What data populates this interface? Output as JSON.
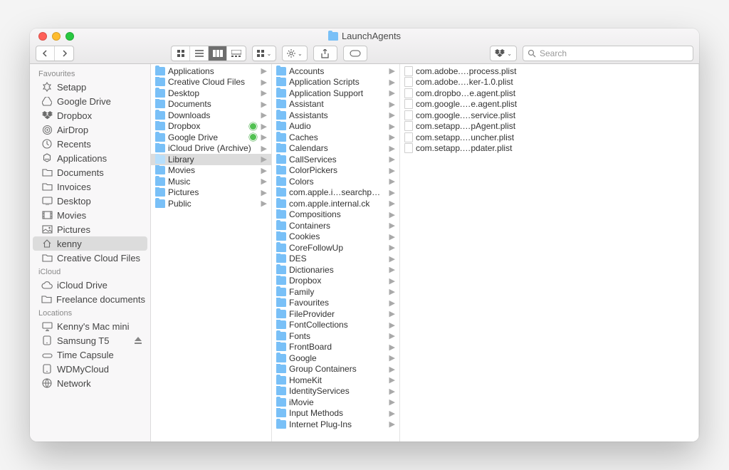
{
  "window": {
    "title": "LaunchAgents"
  },
  "search": {
    "placeholder": "Search"
  },
  "sidebar": {
    "sections": [
      {
        "title": "Favourites",
        "items": [
          {
            "icon": "setapp",
            "label": "Setapp"
          },
          {
            "icon": "gdrive",
            "label": "Google Drive"
          },
          {
            "icon": "dropbox",
            "label": "Dropbox"
          },
          {
            "icon": "airdrop",
            "label": "AirDrop"
          },
          {
            "icon": "recents",
            "label": "Recents"
          },
          {
            "icon": "apps",
            "label": "Applications"
          },
          {
            "icon": "folder",
            "label": "Documents"
          },
          {
            "icon": "folder",
            "label": "Invoices"
          },
          {
            "icon": "desktop",
            "label": "Desktop"
          },
          {
            "icon": "movies",
            "label": "Movies"
          },
          {
            "icon": "pictures",
            "label": "Pictures"
          },
          {
            "icon": "home",
            "label": "kenny",
            "selected": true
          },
          {
            "icon": "folder",
            "label": "Creative Cloud Files"
          }
        ]
      },
      {
        "title": "iCloud",
        "items": [
          {
            "icon": "cloud",
            "label": "iCloud Drive"
          },
          {
            "icon": "folder",
            "label": "Freelance documents"
          }
        ]
      },
      {
        "title": "Locations",
        "items": [
          {
            "icon": "imac",
            "label": "Kenny's Mac mini"
          },
          {
            "icon": "disk",
            "label": "Samsung T5",
            "eject": true
          },
          {
            "icon": "timecap",
            "label": "Time Capsule"
          },
          {
            "icon": "disk",
            "label": "WDMyCloud"
          },
          {
            "icon": "globe",
            "label": "Network"
          }
        ]
      }
    ]
  },
  "columns": [
    {
      "items": [
        {
          "t": "folder",
          "label": "Applications",
          "chev": true
        },
        {
          "t": "folder",
          "label": "Creative Cloud Files",
          "chev": true
        },
        {
          "t": "folder",
          "label": "Desktop",
          "chev": true
        },
        {
          "t": "folder",
          "label": "Documents",
          "chev": true
        },
        {
          "t": "folder",
          "label": "Downloads",
          "chev": true
        },
        {
          "t": "folder",
          "label": "Dropbox",
          "chev": true,
          "sync": true
        },
        {
          "t": "folder",
          "label": "Google Drive",
          "chev": true,
          "sync": true
        },
        {
          "t": "folder",
          "label": "iCloud Drive (Archive)",
          "chev": true
        },
        {
          "t": "folder-lite",
          "label": "Library",
          "chev": true,
          "selected": true
        },
        {
          "t": "folder",
          "label": "Movies",
          "chev": true
        },
        {
          "t": "folder",
          "label": "Music",
          "chev": true
        },
        {
          "t": "folder",
          "label": "Pictures",
          "chev": true
        },
        {
          "t": "folder",
          "label": "Public",
          "chev": true
        }
      ]
    },
    {
      "items": [
        {
          "t": "folder",
          "label": "Accounts",
          "chev": true
        },
        {
          "t": "folder",
          "label": "Application Scripts",
          "chev": true
        },
        {
          "t": "folder",
          "label": "Application Support",
          "chev": true
        },
        {
          "t": "folder",
          "label": "Assistant",
          "chev": true
        },
        {
          "t": "folder",
          "label": "Assistants",
          "chev": true
        },
        {
          "t": "folder",
          "label": "Audio",
          "chev": true
        },
        {
          "t": "folder",
          "label": "Caches",
          "chev": true
        },
        {
          "t": "folder",
          "label": "Calendars",
          "chev": true
        },
        {
          "t": "folder",
          "label": "CallServices",
          "chev": true
        },
        {
          "t": "folder",
          "label": "ColorPickers",
          "chev": true
        },
        {
          "t": "folder",
          "label": "Colors",
          "chev": true
        },
        {
          "t": "folder",
          "label": "com.apple.i…searchpartyd",
          "chev": true
        },
        {
          "t": "folder",
          "label": "com.apple.internal.ck",
          "chev": true
        },
        {
          "t": "folder",
          "label": "Compositions",
          "chev": true
        },
        {
          "t": "folder",
          "label": "Containers",
          "chev": true
        },
        {
          "t": "folder",
          "label": "Cookies",
          "chev": true
        },
        {
          "t": "folder",
          "label": "CoreFollowUp",
          "chev": true
        },
        {
          "t": "folder",
          "label": "DES",
          "chev": true
        },
        {
          "t": "folder",
          "label": "Dictionaries",
          "chev": true
        },
        {
          "t": "folder",
          "label": "Dropbox",
          "chev": true
        },
        {
          "t": "folder",
          "label": "Family",
          "chev": true
        },
        {
          "t": "folder",
          "label": "Favourites",
          "chev": true
        },
        {
          "t": "folder",
          "label": "FileProvider",
          "chev": true
        },
        {
          "t": "folder",
          "label": "FontCollections",
          "chev": true
        },
        {
          "t": "folder",
          "label": "Fonts",
          "chev": true
        },
        {
          "t": "folder",
          "label": "FrontBoard",
          "chev": true
        },
        {
          "t": "folder",
          "label": "Google",
          "chev": true
        },
        {
          "t": "folder",
          "label": "Group Containers",
          "chev": true
        },
        {
          "t": "folder",
          "label": "HomeKit",
          "chev": true
        },
        {
          "t": "folder",
          "label": "IdentityServices",
          "chev": true
        },
        {
          "t": "folder",
          "label": "iMovie",
          "chev": true
        },
        {
          "t": "folder",
          "label": "Input Methods",
          "chev": true
        },
        {
          "t": "folder",
          "label": "Internet Plug-Ins",
          "chev": true
        }
      ]
    },
    {
      "items": [
        {
          "t": "doc",
          "label": "com.adobe.…process.plist"
        },
        {
          "t": "doc",
          "label": "com.adobe.…ker-1.0.plist"
        },
        {
          "t": "doc",
          "label": "com.dropbo…e.agent.plist"
        },
        {
          "t": "doc",
          "label": "com.google.…e.agent.plist"
        },
        {
          "t": "doc",
          "label": "com.google.…service.plist"
        },
        {
          "t": "doc",
          "label": "com.setapp.…pAgent.plist"
        },
        {
          "t": "doc",
          "label": "com.setapp.…uncher.plist"
        },
        {
          "t": "doc",
          "label": "com.setapp.…pdater.plist"
        }
      ]
    }
  ]
}
